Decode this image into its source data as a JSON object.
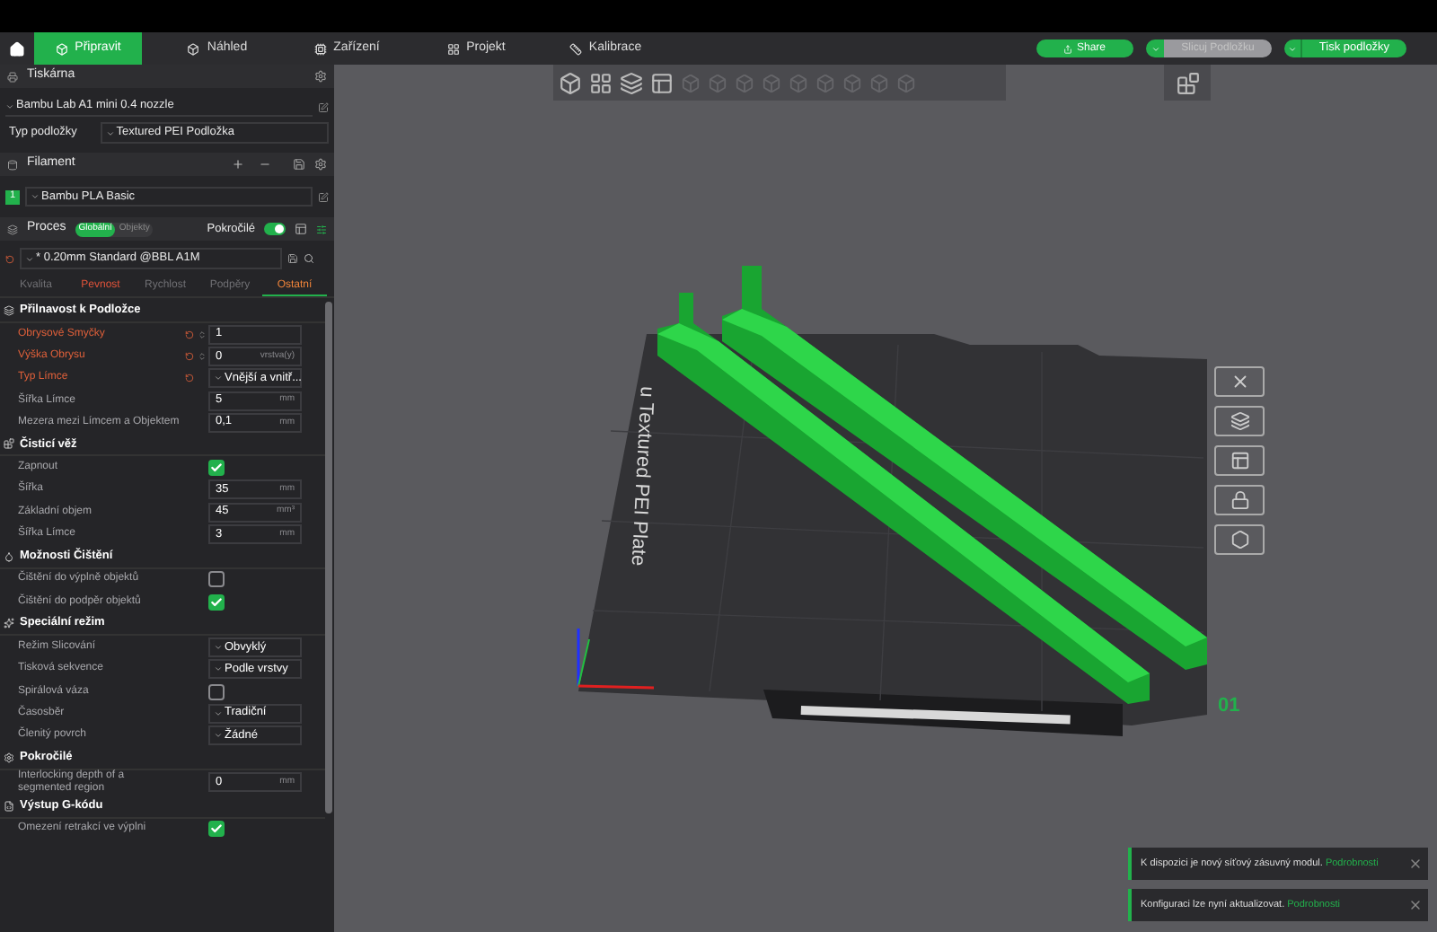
{
  "tabs": [
    {
      "label": "Připravit",
      "selected": true
    },
    {
      "label": "Náhled",
      "selected": false
    },
    {
      "label": "Zařízení",
      "selected": false
    },
    {
      "label": "Projekt",
      "selected": false
    },
    {
      "label": "Kalibrace",
      "selected": false
    }
  ],
  "actions": {
    "share": "Share",
    "slice": {
      "label": "Slicuj Podložku",
      "disabled": true
    },
    "print": "Tisk podložky"
  },
  "printer": {
    "title": "Tiskárna",
    "preset": "Bambu Lab A1 mini 0.4 nozzle",
    "plate_label": "Typ podložky",
    "plate_type": "Textured PEI Podložka"
  },
  "filament": {
    "title": "Filament",
    "items": [
      {
        "index": "1",
        "name": "Bambu PLA Basic",
        "color": "#22b14c"
      }
    ]
  },
  "process": {
    "title": "Proces",
    "scope": [
      {
        "label": "Globální",
        "selected": true
      },
      {
        "label": "Objekty",
        "selected": false
      }
    ],
    "advanced_label": "Pokročilé",
    "advanced": true,
    "preset": "* 0.20mm Standard @BBL A1M"
  },
  "setting_tabs": [
    {
      "label": "Kvalita",
      "selected": false,
      "modified": false
    },
    {
      "label": "Pevnost",
      "selected": false,
      "modified": true
    },
    {
      "label": "Rychlost",
      "selected": false,
      "modified": false
    },
    {
      "label": "Podpěry",
      "selected": false,
      "modified": false
    },
    {
      "label": "Ostatní",
      "selected": true,
      "modified": true
    }
  ],
  "sections": [
    {
      "title": "Přilnavost k Podložce",
      "items": [
        {
          "kind": "input",
          "label": "Obrysové Smyčky",
          "modified": true,
          "spinner": true,
          "value": "1"
        },
        {
          "kind": "input",
          "label": "Výška Obrysu",
          "modified": true,
          "spinner": true,
          "value": "0",
          "unit": "vrstva(y)"
        },
        {
          "kind": "select",
          "label": "Typ Límce",
          "modified": true,
          "value": "Vnější a vnitř..."
        },
        {
          "kind": "input",
          "label": "Šířka Límce",
          "modified": false,
          "value": "5",
          "unit": "mm"
        },
        {
          "kind": "input",
          "label": "Mezera mezi Límcem a Objektem",
          "modified": false,
          "value": "0,1",
          "unit": "mm"
        }
      ]
    },
    {
      "title": "Čisticí věž",
      "items": [
        {
          "kind": "checkbox",
          "label": "Zapnout",
          "checked": true
        },
        {
          "kind": "input",
          "label": "Šířka",
          "modified": false,
          "value": "35",
          "unit": "mm"
        },
        {
          "kind": "input",
          "label": "Základní objem",
          "modified": false,
          "value": "45",
          "unit": "mm³"
        },
        {
          "kind": "input",
          "label": "Šířka Límce",
          "modified": false,
          "value": "3",
          "unit": "mm"
        }
      ]
    },
    {
      "title": "Možnosti Čištění",
      "items": [
        {
          "kind": "checkbox",
          "label": "Čištění do výplně objektů",
          "checked": false
        },
        {
          "kind": "checkbox",
          "label": "Čištění do podpěr objektů",
          "checked": true
        }
      ]
    },
    {
      "title": "Speciální režim",
      "items": [
        {
          "kind": "select",
          "label": "Režim Slicování",
          "modified": false,
          "value": "Obvyklý"
        },
        {
          "kind": "select",
          "label": "Tisková sekvence",
          "modified": false,
          "value": "Podle vrstvy"
        },
        {
          "kind": "checkbox",
          "label": "Spirálová váza",
          "checked": false
        },
        {
          "kind": "select",
          "label": "Časosběr",
          "modified": false,
          "value": "Tradiční"
        },
        {
          "kind": "select",
          "label": "Členitý povrch",
          "modified": false,
          "value": "Žádné"
        }
      ]
    },
    {
      "title": "Pokročilé",
      "items": [
        {
          "kind": "input",
          "label": "Interlocking depth of a segmented region",
          "modified": false,
          "value": "0",
          "unit": "mm"
        }
      ]
    },
    {
      "title": "Výstup G-kódu",
      "items": [
        {
          "kind": "checkbox",
          "label": "Omezení retrakcí ve výplni",
          "checked": true
        }
      ]
    }
  ],
  "viewport": {
    "plate_label": "u Textured PEI Plate",
    "plate_number": "01"
  },
  "notifications": [
    {
      "text": "K dispozici je nový síťový zásuvný modul.",
      "link": "Podrobnosti"
    },
    {
      "text": "Konfiguraci lze nyní aktualizovat.",
      "link": "Podrobnosti"
    }
  ]
}
